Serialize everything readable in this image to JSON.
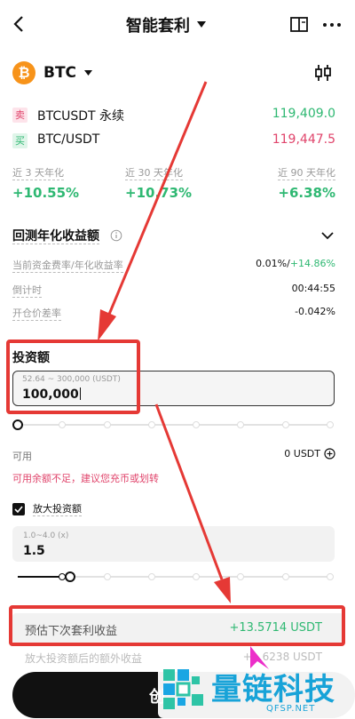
{
  "header": {
    "title": "智能套利",
    "back_icon": "chevron-left-icon",
    "menu_icon": "more-icon"
  },
  "coin": {
    "symbol": "BTC",
    "icon_letter": "₿"
  },
  "pairs": [
    {
      "tag": "卖",
      "name": "BTCUSDT 永续",
      "price": "119,409.0",
      "tag_color": "#e0446b",
      "price_color": "#2eb872"
    },
    {
      "tag": "买",
      "name": "BTC/USDT",
      "price": "119,447.5",
      "tag_color": "#2eb872",
      "price_color": "#e0446b"
    }
  ],
  "apy": [
    {
      "label": "近 3 天年化",
      "value": "+10.55%"
    },
    {
      "label": "近 30 天年化",
      "value": "+10.73%"
    },
    {
      "label": "近 90 天年化",
      "value": "+6.38%"
    }
  ],
  "backtest": {
    "title": "回测年化收益额"
  },
  "info_rows": [
    {
      "label": "当前资金费率/年化收益率",
      "value": "0.01%/",
      "value_extra": "+14.86%"
    },
    {
      "label": "倒计时",
      "value": "00:44:55",
      "value_extra": ""
    },
    {
      "label": "开仓价差率",
      "value": "-0.042%",
      "value_extra": ""
    }
  ],
  "invest": {
    "title": "投资额",
    "range_hint": "52.64 ~ 300,000 (USDT)",
    "value": "100,000",
    "slider_fraction": 0
  },
  "available": {
    "label": "可用",
    "value": "0 USDT",
    "warning": "可用余额不足，建议您充币或划转"
  },
  "leverage": {
    "checkbox_label": "放大投资额",
    "checked": true,
    "range_hint": "1.0~4.0 (x)",
    "value": "1.5",
    "slider_fraction": 0.1667
  },
  "estimate": {
    "label": "预估下次套利收益",
    "value": "+13.5714 USDT"
  },
  "extra_row": {
    "label": "放大投资额后的额外收益",
    "value": "+…6238 USDT"
  },
  "create_button": {
    "label": "创"
  },
  "watermark": {
    "text": "量链科技",
    "sub": "QFSP.NET"
  },
  "colors": {
    "accent_green": "#2eb872",
    "accent_red": "#e0446b",
    "highlight_red": "#e53935",
    "btc_orange": "#f7931a"
  }
}
